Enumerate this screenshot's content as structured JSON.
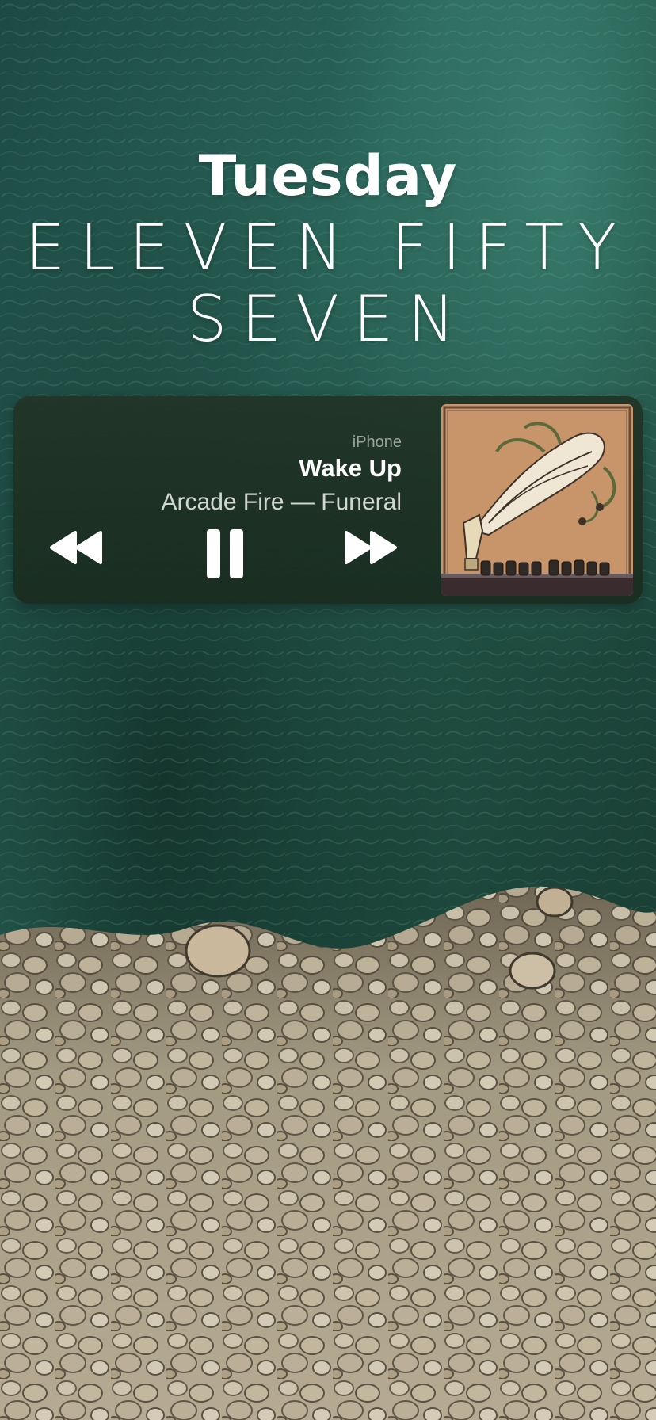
{
  "lockscreen": {
    "day": "Tuesday",
    "time_line_1": "ELEVEN FIFTY",
    "time_line_2": "SEVEN"
  },
  "now_playing": {
    "device": "iPhone",
    "song": "Wake Up",
    "artist_album": "Arcade Fire — Funeral",
    "controls": {
      "rewind_icon": "backward-icon",
      "pause_icon": "pause-icon",
      "forward_icon": "forward-icon"
    }
  },
  "colors": {
    "water_deep": "#1f4a42",
    "water_light": "#2d6b5e",
    "rocks": "#b8aa90",
    "widget_bg": "#213426",
    "album_bg": "#c8956a"
  }
}
